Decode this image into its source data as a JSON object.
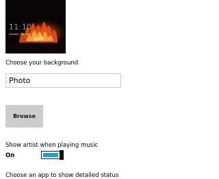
{
  "lock_screen_preview": {
    "time": "11:10",
    "date": "Tuesday, February 2"
  },
  "background": {
    "label": "Choose your background",
    "selected": "Photo",
    "browse_label": "Browse"
  },
  "music": {
    "label": "Show artist when playing music",
    "toggle_state": "On",
    "enabled": true
  },
  "detailed_status": {
    "label": "Choose an app to show detailed status"
  },
  "colors": {
    "toggle_accent": "#1ba1e2",
    "button_bg": "#cccccc",
    "input_border": "#c9c9c9"
  }
}
